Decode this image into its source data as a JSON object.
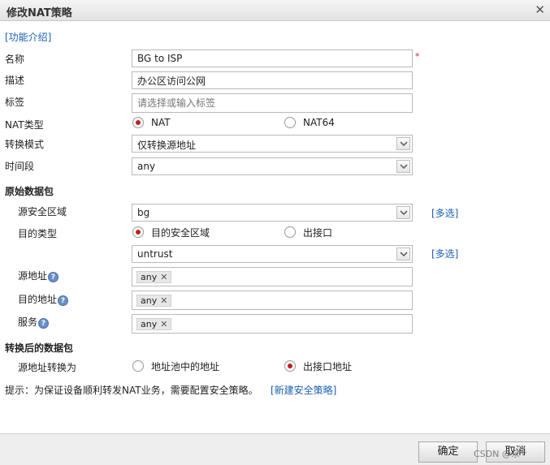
{
  "dialog": {
    "title": "修改NAT策略"
  },
  "intro_link": "[功能介绍]",
  "fields": {
    "name": {
      "label": "名称",
      "value": "BG to ISP",
      "required_mark": "*"
    },
    "description": {
      "label": "描述",
      "value": "办公区访问公网"
    },
    "tags": {
      "label": "标签",
      "placeholder": "请选择或输入标签"
    },
    "nat_type": {
      "label": "NAT类型",
      "options": [
        "NAT",
        "NAT64"
      ],
      "selected": "NAT"
    },
    "mode": {
      "label": "转换模式",
      "value": "仅转换源地址"
    },
    "time_range": {
      "label": "时间段",
      "value": "any"
    }
  },
  "original_packet": {
    "title": "原始数据包",
    "src_zone": {
      "label": "源安全区域",
      "value": "bg",
      "multi_link": "[多选]"
    },
    "dst_type": {
      "label": "目的类型",
      "options": [
        "目的安全区域",
        "出接口"
      ],
      "selected": "目的安全区域"
    },
    "dst_zone": {
      "value": "untrust",
      "multi_link": "[多选]"
    },
    "src_addr": {
      "label": "源地址",
      "tag": "any"
    },
    "dst_addr": {
      "label": "目的地址",
      "tag": "any"
    },
    "service": {
      "label": "服务",
      "tag": "any"
    },
    "help_glyph": "?",
    "remove_glyph": "✕"
  },
  "translated_packet": {
    "title": "转换后的数据包",
    "src_translate": {
      "label": "源地址转换为",
      "options": [
        "地址池中的地址",
        "出接口地址"
      ],
      "selected": "出接口地址"
    }
  },
  "hint": {
    "text": "提示：为保证设备顺利转发NAT业务，需要配置安全策略。",
    "link": "[新建安全策略]"
  },
  "buttons": {
    "ok": "确定",
    "cancel": "取消"
  },
  "watermark": "CSDN @东^",
  "colors": {
    "link": "#1a5fb4",
    "radio_selected": "#c02020",
    "required": "#dd2222"
  }
}
